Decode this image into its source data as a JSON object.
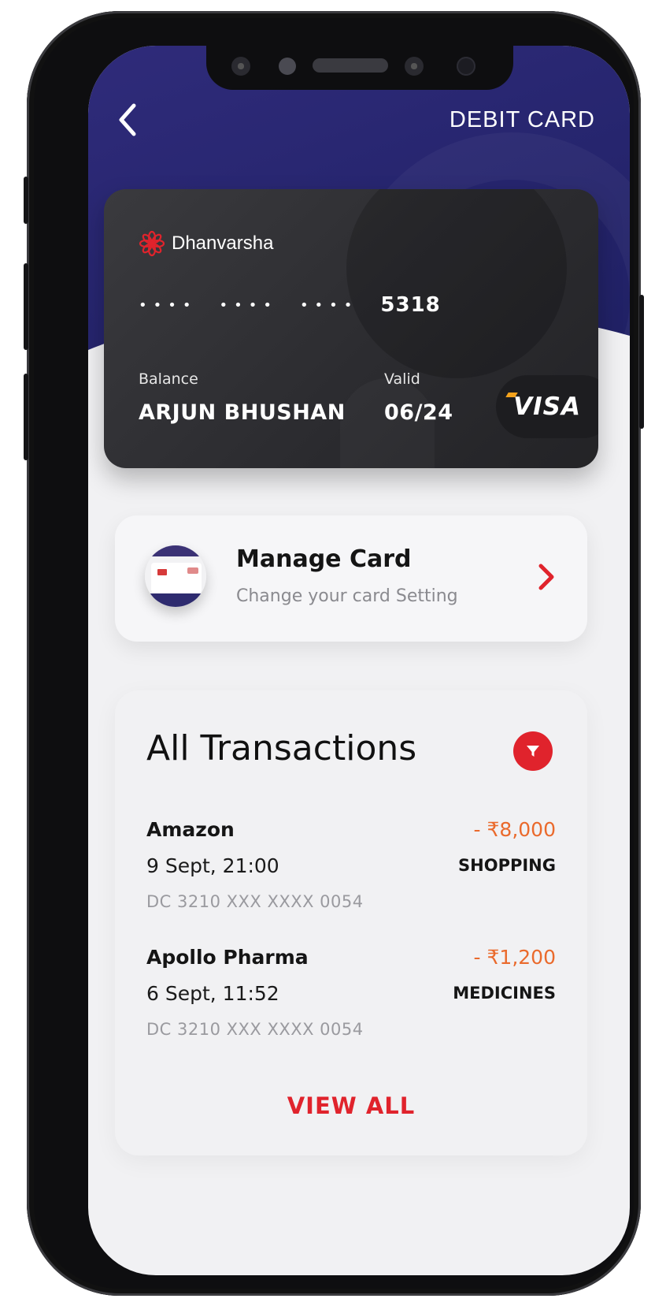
{
  "header": {
    "back_icon": "chevron-left-icon",
    "title": "DEBIT CARD"
  },
  "card": {
    "brand_name": "Dhanvarsha",
    "masked_groups": [
      "••••",
      "••••",
      "••••"
    ],
    "last4": "5318",
    "holder_label": "Balance",
    "holder_name": "ARJUN BHUSHAN",
    "valid_label": "Valid",
    "valid_value": "06/24",
    "network": "VISA"
  },
  "manage_card": {
    "title": "Manage Card",
    "subtitle": "Change your card Setting",
    "chevron_icon": "chevron-right-icon"
  },
  "transactions": {
    "title": "All Transactions",
    "filter_icon": "filter-icon",
    "items": [
      {
        "merchant": "Amazon",
        "datetime": "9 Sept, 21:00",
        "account": "DC 3210 XXX XXXX 0054",
        "amount": "- ₹8,000",
        "category": "SHOPPING"
      },
      {
        "merchant": "Apollo Pharma",
        "datetime": "6 Sept, 11:52",
        "account": "DC 3210 XXX XXXX 0054",
        "amount": "- ₹1,200",
        "category": "MEDICINES"
      }
    ],
    "view_all_label": "VIEW ALL"
  },
  "colors": {
    "header_bg": "#2a2870",
    "accent_red": "#e0232c",
    "amount_orange": "#ea6a2c",
    "card_dark": "#2e2e32"
  }
}
